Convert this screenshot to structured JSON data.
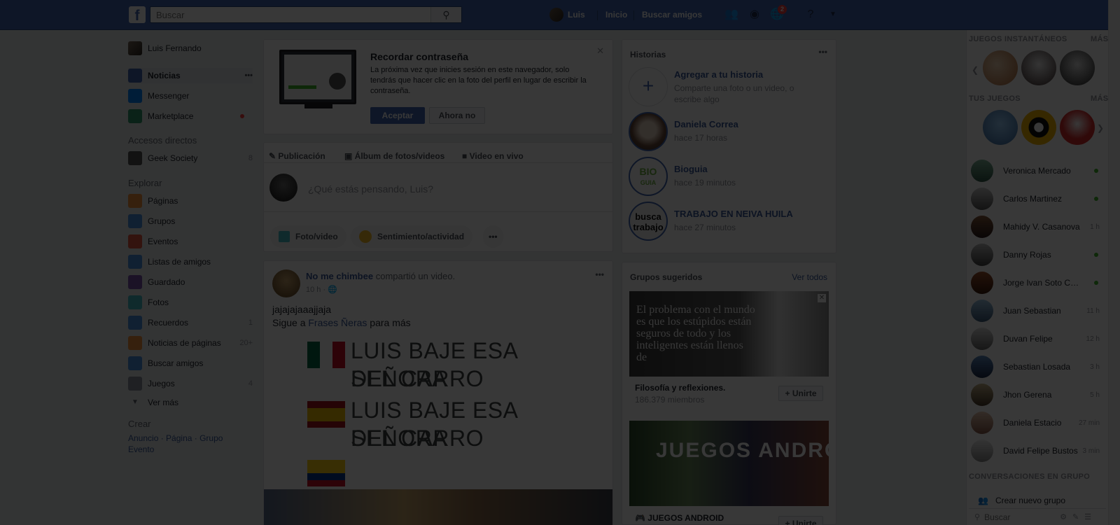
{
  "topbar": {
    "logo": "f",
    "search_placeholder": "Buscar",
    "user_name": "Luis",
    "home": "Inicio",
    "find_friends": "Buscar amigos",
    "notifications_count": "2"
  },
  "left_nav": {
    "profile_name": "Luis Fernando",
    "items": [
      {
        "label": "Noticias",
        "count": ""
      },
      {
        "label": "Messenger",
        "count": ""
      },
      {
        "label": "Marketplace",
        "count": ""
      }
    ],
    "shortcuts_title": "Accesos directos",
    "shortcuts": [
      {
        "label": "Geek Society",
        "count": "8"
      }
    ],
    "explore_title": "Explorar",
    "explore": [
      {
        "label": "Páginas",
        "count": ""
      },
      {
        "label": "Grupos",
        "count": ""
      },
      {
        "label": "Eventos",
        "count": ""
      },
      {
        "label": "Listas de amigos",
        "count": ""
      },
      {
        "label": "Guardado",
        "count": ""
      },
      {
        "label": "Fotos",
        "count": ""
      },
      {
        "label": "Recuerdos",
        "count": "1"
      },
      {
        "label": "Noticias de páginas",
        "count": "20+"
      },
      {
        "label": "Buscar amigos",
        "count": ""
      },
      {
        "label": "Juegos",
        "count": "4"
      }
    ],
    "see_more": "Ver más",
    "create_title": "Crear",
    "create_links": [
      "Anuncio",
      "Página",
      "Grupo",
      "Evento"
    ]
  },
  "password_card": {
    "title": "Recordar contraseña",
    "body": "La próxima vez que inicies sesión en este navegador, solo tendrás que hacer clic en la foto del perfil en lugar de escribir la contraseña.",
    "accept": "Aceptar",
    "not_now": "Ahora no"
  },
  "composer": {
    "tabs": [
      "Publicación",
      "Álbum de fotos/videos",
      "Video en vivo"
    ],
    "placeholder": "¿Qué estás pensando, Luis?",
    "actions": [
      "Foto/video",
      "Sentimiento/actividad"
    ]
  },
  "post": {
    "author": "No me chimbee",
    "action": "compartió un video.",
    "time": "10 h",
    "text_line1": "jajajajaaajjaja",
    "text_line2_prefix": "Sigue a ",
    "text_line2_link": "Frases Ñeras",
    "text_line2_suffix": " para más",
    "big_line1": "LUIS BAJE ESA SEÑORA",
    "big_line2": "DEL CARRO",
    "big_line3": "LUIS BAJE ESA SEÑORA",
    "big_line4": "DEL CARRO"
  },
  "stories": {
    "title": "Historias",
    "add_title": "Agregar a tu historia",
    "add_sub": "Comparte una foto o un video, o escribe algo",
    "items": [
      {
        "name": "Daniela Correa",
        "time": "hace 17 horas"
      },
      {
        "name": "Bioguia",
        "time": "hace 19 minutos"
      },
      {
        "name": "TRABAJO EN NEIVA HUILA",
        "time": "hace 27 minutos"
      }
    ],
    "bio_logo_top": "BIO",
    "bio_logo_bottom": "GUIA",
    "trabajo_logo_top": "busca",
    "trabajo_logo_bottom": "trabajo"
  },
  "groups": {
    "title": "Grupos sugeridos",
    "see_all": "Ver todos",
    "items": [
      {
        "name": "Filosofía y reflexiones.",
        "members": "186.379 miembros",
        "join": "+ Unirte",
        "banner_text": "El problema con el mundo es que los estúpidos están seguros de todo y los inteligentes están llenos de"
      },
      {
        "name": "JUEGOS ANDROID",
        "members": "",
        "join": "+ Unirte",
        "banner_text": "JUEGOS ANDROID"
      }
    ]
  },
  "chat": {
    "instant_games": "JUEGOS INSTANTÁNEOS",
    "your_games": "TUS JUEGOS",
    "more": "MÁS",
    "contacts": [
      {
        "name": "Veronica Mercado",
        "status": "online"
      },
      {
        "name": "Carlos Martinez",
        "status": "online"
      },
      {
        "name": "Mahidy V. Casanova",
        "status": "1 h"
      },
      {
        "name": "Danny Rojas",
        "status": "online"
      },
      {
        "name": "Jorge Ivan Soto Castro",
        "status": "online"
      },
      {
        "name": "Juan Sebastian",
        "status": "11 h"
      },
      {
        "name": "Duvan Felipe",
        "status": "12 h"
      },
      {
        "name": "Sebastian Losada",
        "status": "3 h"
      },
      {
        "name": "Jhon Gerena",
        "status": "5 h"
      },
      {
        "name": "Daniela Estacio",
        "status": "27 min"
      },
      {
        "name": "David Felipe Bustos",
        "status": "3 min"
      }
    ],
    "group_convos": "CONVERSACIONES EN GRUPO",
    "create_group": "Crear nuevo grupo",
    "search_placeholder": "Buscar"
  },
  "colors": {
    "brand": "#4267b2",
    "link": "#365899",
    "overlay": "rgba(0,0,0,0.78)"
  }
}
